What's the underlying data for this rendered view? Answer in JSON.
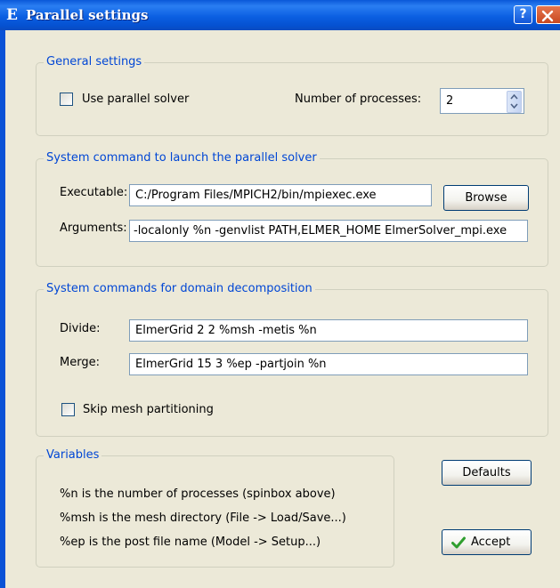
{
  "window": {
    "app_icon_letter": "E",
    "title": "Parallel settings",
    "help_label": "?"
  },
  "general": {
    "legend": "General settings",
    "use_parallel_label": "Use parallel solver",
    "use_parallel_checked": false,
    "num_processes_label": "Number of processes:",
    "num_processes_value": "2"
  },
  "system_command": {
    "legend": "System command to launch the parallel solver",
    "executable_label": "Executable:",
    "executable_value": "C:/Program Files/MPICH2/bin/mpiexec.exe",
    "browse_label": "Browse",
    "arguments_label": "Arguments:",
    "arguments_value": "-localonly %n -genvlist PATH,ELMER_HOME ElmerSolver_mpi.exe"
  },
  "domain": {
    "legend": "System commands for domain decomposition",
    "divide_label": "Divide:",
    "divide_value": "ElmerGrid 2 2 %msh -metis %n",
    "merge_label": "Merge:",
    "merge_value": "ElmerGrid 15 3 %ep -partjoin %n",
    "skip_label": "Skip mesh partitioning",
    "skip_checked": false
  },
  "variables": {
    "legend": "Variables",
    "lines": [
      "%n is the number of processes (spinbox above)",
      "%msh is the mesh directory (File -> Load/Save...)",
      "%ep is the post file name (Model -> Setup...)"
    ]
  },
  "buttons": {
    "defaults_label": "Defaults",
    "accept_label": "Accept"
  },
  "colors": {
    "titlebar": "#0a58d8",
    "legend_text": "#0046d5",
    "dialog_bg": "#ece9d8",
    "accept_check": "#2f9e2f"
  }
}
